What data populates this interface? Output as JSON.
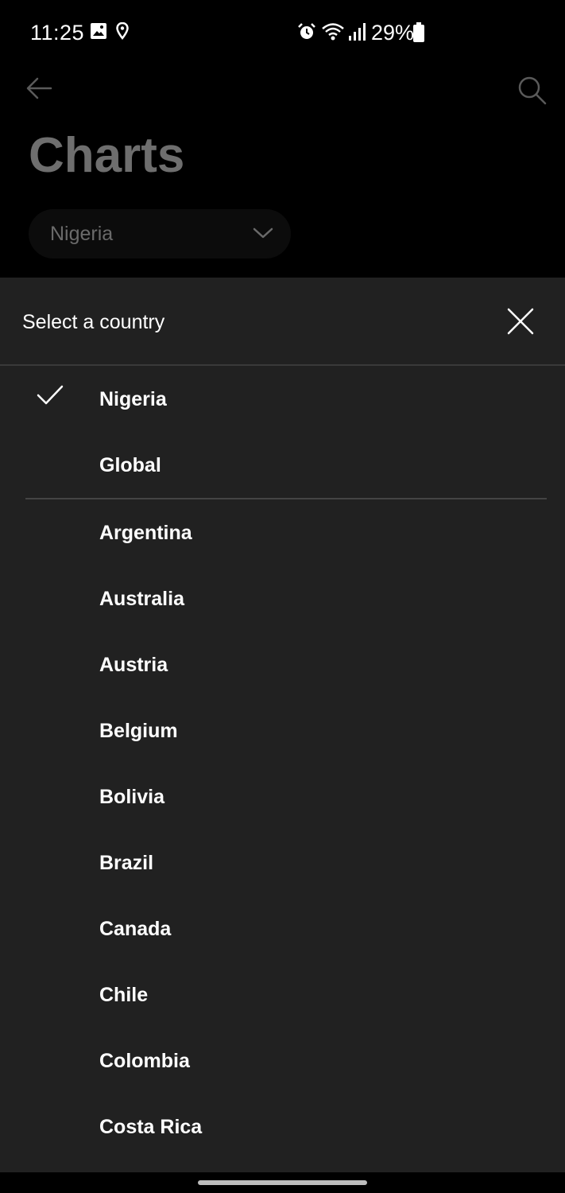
{
  "status_bar": {
    "time": "11:25",
    "battery": "29%",
    "icons": [
      "image-icon",
      "location-icon",
      "alarm-icon",
      "wifi-icon",
      "signal-icon",
      "battery-icon"
    ]
  },
  "app_bar": {
    "back_icon": "back-arrow-icon",
    "search_icon": "search-icon",
    "title": "Charts",
    "country_selector": {
      "selected": "Nigeria",
      "icon": "chevron-down-icon"
    }
  },
  "sheet": {
    "title": "Select a country",
    "close_icon": "close-icon",
    "options": [
      {
        "label": "Nigeria",
        "selected": true
      },
      {
        "label": "Global",
        "selected": false
      },
      {
        "label": "Argentina",
        "selected": false
      },
      {
        "label": "Australia",
        "selected": false
      },
      {
        "label": "Austria",
        "selected": false
      },
      {
        "label": "Belgium",
        "selected": false
      },
      {
        "label": "Bolivia",
        "selected": false
      },
      {
        "label": "Brazil",
        "selected": false
      },
      {
        "label": "Canada",
        "selected": false
      },
      {
        "label": "Chile",
        "selected": false
      },
      {
        "label": "Colombia",
        "selected": false
      },
      {
        "label": "Costa Rica",
        "selected": false
      }
    ]
  },
  "colors": {
    "sheet_background": "#212121",
    "page_background": "#000000",
    "text": "#ffffff",
    "dimmed_text": "#6e6e6e"
  }
}
